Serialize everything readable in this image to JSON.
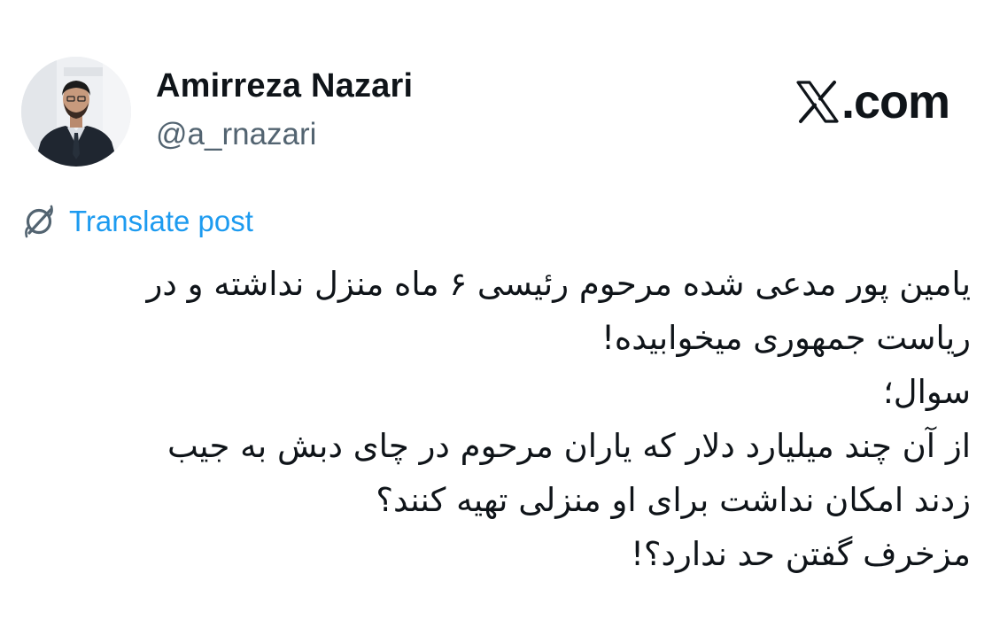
{
  "author": {
    "display_name": "Amirreza Nazari",
    "handle": "@a_rnazari",
    "avatar_icon": "user-avatar-photo"
  },
  "brand": {
    "logo_icon": "x-logo-icon",
    "text": ".com"
  },
  "translate": {
    "icon": "translate-globe-icon",
    "label": "Translate post",
    "color": "#1d9bf0"
  },
  "post": {
    "lines": [
      "یامین پور مدعی شده مرحوم رئیسی ۶ ماه منزل نداشته و در",
      "ریاست جمهوری میخوابیده!",
      "سوال؛",
      "از آن چند میلیارد دلار که یاران مرحوم در چای دبش به جیب",
      "زدند امکان نداشت برای او منزلی تهیه کنند؟",
      "مزخرف گفتن حد ندارد؟!"
    ]
  },
  "colors": {
    "text": "#0f1419",
    "secondary": "#536471",
    "accent": "#1d9bf0",
    "background": "#ffffff"
  }
}
